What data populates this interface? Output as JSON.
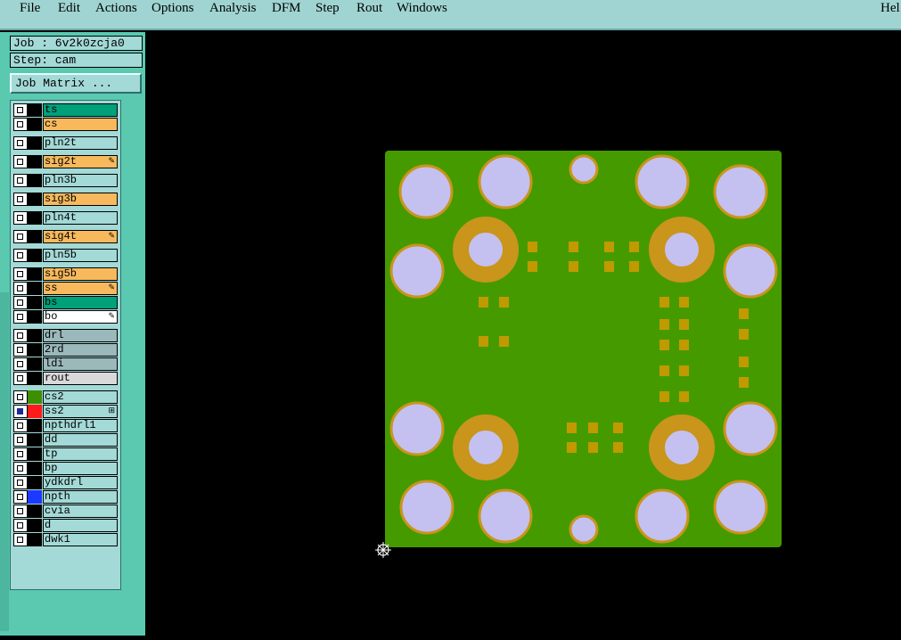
{
  "menu": {
    "items": [
      {
        "label": "File"
      },
      {
        "label": "Edit"
      },
      {
        "label": "Actions"
      },
      {
        "label": "Options"
      },
      {
        "label": "Analysis"
      },
      {
        "label": "DFM"
      },
      {
        "label": "Step"
      },
      {
        "label": "Rout"
      },
      {
        "label": "Windows"
      },
      {
        "label": "Hel"
      }
    ]
  },
  "job": {
    "job_label": "Job : 6v2k0zcja0",
    "step_label": "Step: cam",
    "matrix_button": "Job Matrix ..."
  },
  "layers": [
    {
      "name": "ts",
      "bg": "#00a07a",
      "swatch": "#000",
      "checked": false,
      "flag": ""
    },
    {
      "name": "cs",
      "bg": "#f7b95c",
      "swatch": "#000",
      "checked": false,
      "flag": ""
    },
    {
      "name": "pln2t",
      "bg": "#a3d9d6",
      "swatch": "#000",
      "checked": false,
      "flag": ""
    },
    {
      "name": "sig2t",
      "bg": "#f7b95c",
      "swatch": "#000",
      "checked": false,
      "flag": "✎"
    },
    {
      "name": "pln3b",
      "bg": "#a3d9d6",
      "swatch": "#000",
      "checked": false,
      "flag": ""
    },
    {
      "name": "sig3b",
      "bg": "#f7b95c",
      "swatch": "#000",
      "checked": false,
      "flag": ""
    },
    {
      "name": "pln4t",
      "bg": "#a3d9d6",
      "swatch": "#000",
      "checked": false,
      "flag": ""
    },
    {
      "name": "sig4t",
      "bg": "#f7b95c",
      "swatch": "#000",
      "checked": false,
      "flag": "✎"
    },
    {
      "name": "pln5b",
      "bg": "#a3d9d6",
      "swatch": "#000",
      "checked": false,
      "flag": ""
    },
    {
      "name": "sig5b",
      "bg": "#f7b95c",
      "swatch": "#000",
      "checked": false,
      "flag": ""
    },
    {
      "name": "ss",
      "bg": "#f7b95c",
      "swatch": "#000",
      "checked": false,
      "flag": "✎"
    },
    {
      "name": "bs",
      "bg": "#00a07a",
      "swatch": "#000",
      "checked": false,
      "flag": ""
    },
    {
      "name": "bo",
      "bg": "#ffffff",
      "swatch": "#000",
      "checked": false,
      "flag": "✎"
    },
    {
      "name": "drl",
      "bg": "#9bb8bb",
      "swatch": "#000",
      "checked": false,
      "flag": ""
    },
    {
      "name": "2rd",
      "bg": "#9bb8bb",
      "swatch": "#000",
      "checked": false,
      "flag": ""
    },
    {
      "name": "ldi",
      "bg": "#9bb8bb",
      "swatch": "#000",
      "checked": false,
      "flag": ""
    },
    {
      "name": "rout",
      "bg": "#d9d9d9",
      "swatch": "#000",
      "checked": false,
      "flag": ""
    },
    {
      "name": "cs2",
      "bg": "#a3d9d6",
      "swatch": "#3c8f00",
      "checked": false,
      "flag": ""
    },
    {
      "name": "ss2",
      "bg": "#a3d9d6",
      "swatch": "#ff1a1a",
      "checked": true,
      "flag": "⊞"
    },
    {
      "name": "npthdrl1",
      "bg": "#a3d9d6",
      "swatch": "#000",
      "checked": false,
      "flag": ""
    },
    {
      "name": "dd",
      "bg": "#a3d9d6",
      "swatch": "#000",
      "checked": false,
      "flag": ""
    },
    {
      "name": "tp",
      "bg": "#a3d9d6",
      "swatch": "#000",
      "checked": false,
      "flag": ""
    },
    {
      "name": "bp",
      "bg": "#a3d9d6",
      "swatch": "#000",
      "checked": false,
      "flag": ""
    },
    {
      "name": "ydkdrl",
      "bg": "#a3d9d6",
      "swatch": "#000",
      "checked": false,
      "flag": ""
    },
    {
      "name": "npth",
      "bg": "#a3d9d6",
      "swatch": "#1a3aff",
      "checked": false,
      "flag": ""
    },
    {
      "name": "cvia",
      "bg": "#a3d9d6",
      "swatch": "#000",
      "checked": false,
      "flag": ""
    },
    {
      "name": "d",
      "bg": "#a3d9d6",
      "swatch": "#000",
      "checked": false,
      "flag": ""
    },
    {
      "name": "dwk1",
      "bg": "#a3d9d6",
      "swatch": "#000",
      "checked": false,
      "flag": ""
    }
  ],
  "colors": {
    "board": "#459a00",
    "hole_fill": "#c4c0f0",
    "hole_ring": "#c9951a",
    "copper": "#c09a00"
  }
}
